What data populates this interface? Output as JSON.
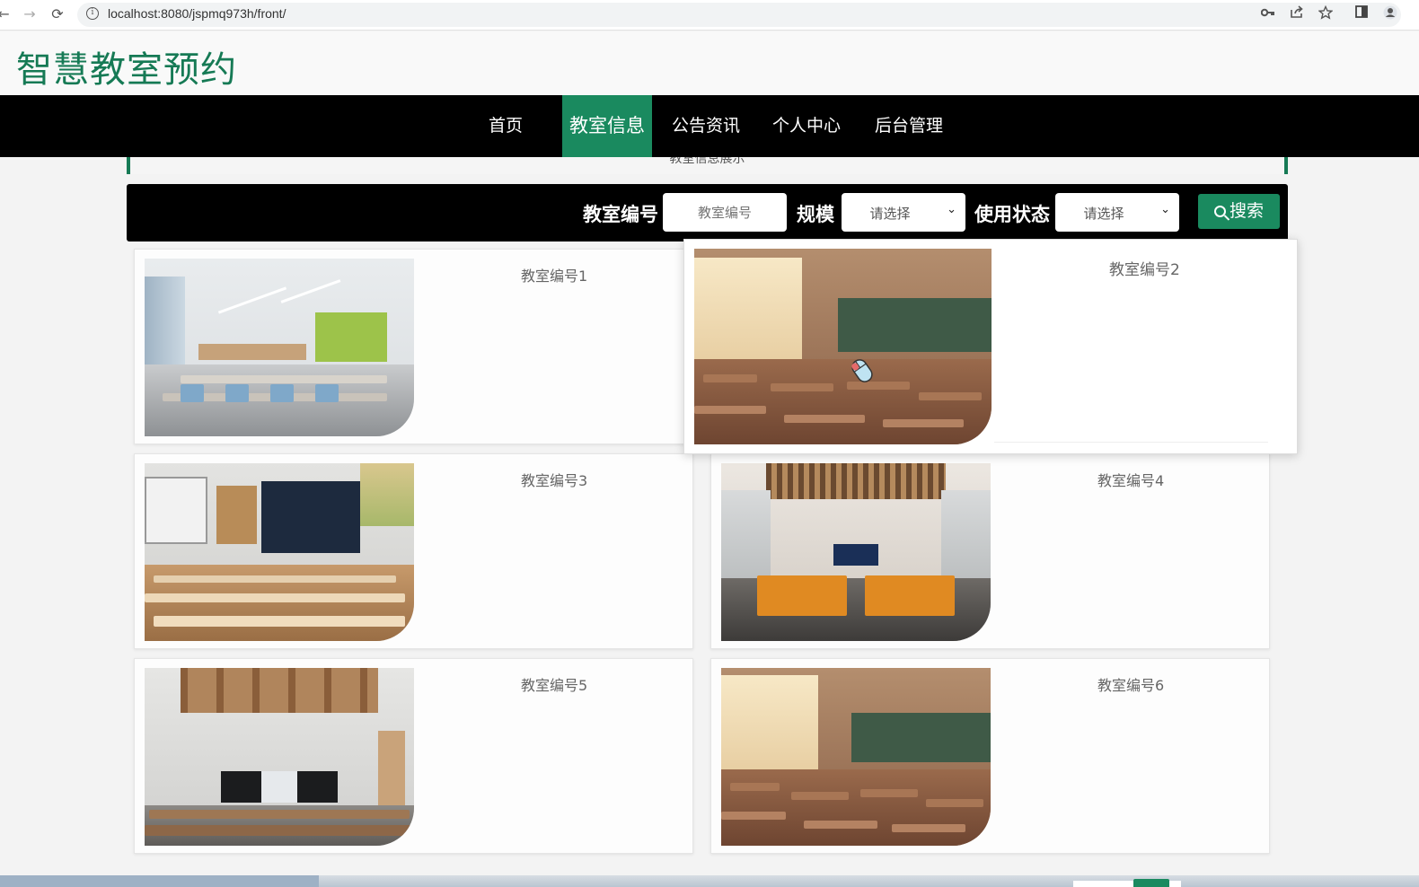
{
  "browser": {
    "url": "localhost:8080/jspmq973h/front/",
    "back_glyph": "←",
    "forward_glyph": "→",
    "reload_glyph": "⟳",
    "icons": [
      "key-icon",
      "share-icon",
      "star-icon",
      "sidebar-icon",
      "profile-icon"
    ]
  },
  "site": {
    "title": "智慧教室预约"
  },
  "nav": {
    "items": [
      {
        "label": "首页"
      },
      {
        "label": "教室信息"
      },
      {
        "label": "公告资讯"
      },
      {
        "label": "个人中心"
      },
      {
        "label": "后台管理"
      }
    ],
    "active_index": 1,
    "active_color": "#1a8a5f"
  },
  "breadcrumb": {
    "text": "教室信息展示"
  },
  "search": {
    "room_label": "教室编号",
    "room_placeholder": "教室编号",
    "scale_label": "规模",
    "scale_value": "请选择",
    "status_label": "使用状态",
    "status_value": "请选择",
    "button_label": "搜索"
  },
  "rooms": [
    {
      "title": "教室编号1"
    },
    {
      "title": "教室编号2"
    },
    {
      "title": "教室编号3"
    },
    {
      "title": "教室编号4"
    },
    {
      "title": "教室编号5"
    },
    {
      "title": "教室编号6"
    }
  ],
  "colors": {
    "brand": "#167a55",
    "nav_bg": "#000000"
  }
}
